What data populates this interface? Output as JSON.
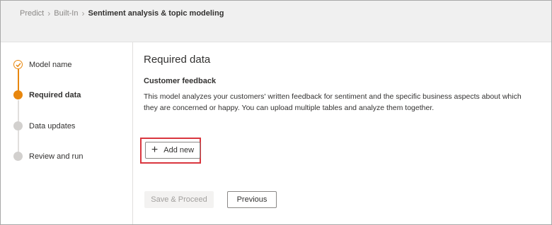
{
  "breadcrumb": {
    "items": [
      "Predict",
      "Built-In"
    ],
    "current": "Sentiment analysis & topic modeling"
  },
  "steps": [
    {
      "label": "Model name",
      "state": "done"
    },
    {
      "label": "Required data",
      "state": "active"
    },
    {
      "label": "Data updates",
      "state": "pending"
    },
    {
      "label": "Review and run",
      "state": "pending"
    }
  ],
  "main": {
    "title": "Required data",
    "subtitle": "Customer feedback",
    "description": "This model analyzes your customers' written feedback for sentiment and the specific business aspects about which they are concerned or happy. You can upload multiple tables and analyze them together.",
    "add_button_label": "Add new",
    "save_button_label": "Save & Proceed",
    "previous_button_label": "Previous"
  },
  "colors": {
    "accent": "#e8870e",
    "highlight": "#d9363e",
    "pending": "#d2d0ce"
  }
}
